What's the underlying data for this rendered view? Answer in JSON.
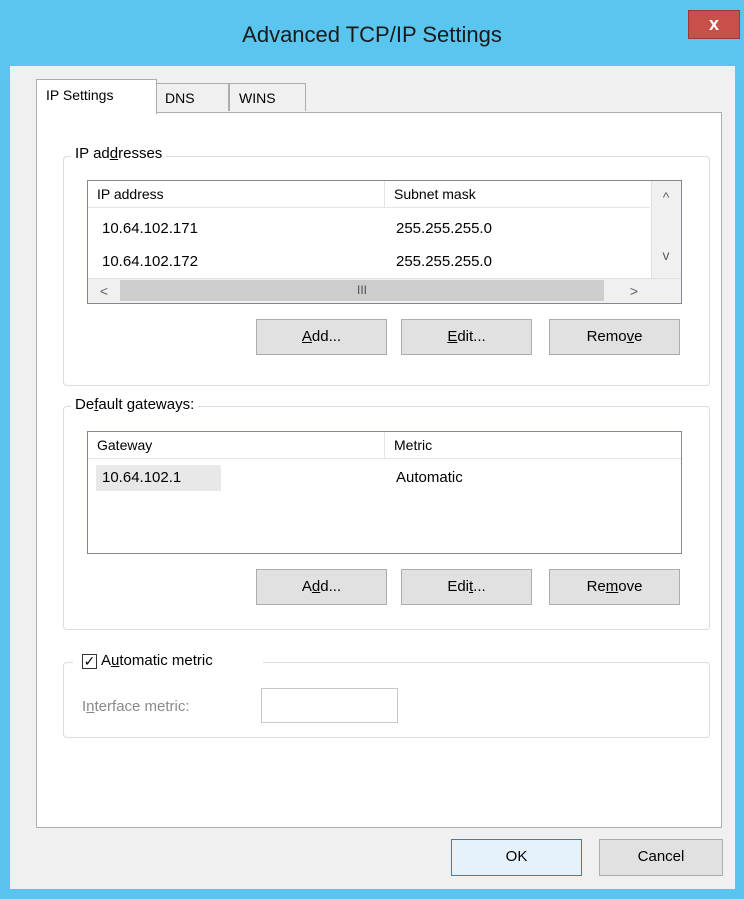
{
  "window": {
    "title": "Advanced TCP/IP Settings",
    "close_label": "x"
  },
  "tabs": [
    {
      "label": "IP Settings",
      "active": true
    },
    {
      "label": "DNS",
      "active": false
    },
    {
      "label": "WINS",
      "active": false
    }
  ],
  "ip_addresses": {
    "group_label_a": "IP ad",
    "group_label_u": "d",
    "group_label_b": "resses",
    "columns": [
      "IP address",
      "Subnet mask"
    ],
    "rows": [
      {
        "ip": "10.64.102.171",
        "mask": "255.255.255.0"
      },
      {
        "ip": "10.64.102.172",
        "mask": "255.255.255.0"
      }
    ],
    "scroll_left": "<",
    "scroll_right": ">",
    "scroll_up": "^",
    "scroll_down": "v",
    "scroll_grip": "III",
    "add_u": "A",
    "add_rest": "dd...",
    "edit_u": "E",
    "edit_rest": "dit...",
    "remove_a": "Remo",
    "remove_u": "v",
    "remove_b": "e"
  },
  "default_gateways": {
    "group_label_a": "De",
    "group_label_u": "f",
    "group_label_b": "ault gateways:",
    "columns": [
      "Gateway",
      "Metric"
    ],
    "rows": [
      {
        "gateway": "10.64.102.1",
        "metric": "Automatic"
      }
    ],
    "add_a": "A",
    "add_u": "d",
    "add_b": "d...",
    "edit_a": "Edi",
    "edit_u": "t",
    "edit_b": "...",
    "remove_a": "Re",
    "remove_u": "m",
    "remove_b": "ove"
  },
  "automatic_metric": {
    "checked": true,
    "check_glyph": "✓",
    "label_a": "A",
    "label_u": "u",
    "label_b": "tomatic metric",
    "interface_label_a": "I",
    "interface_label_u": "n",
    "interface_label_b": "terface metric:",
    "interface_value": ""
  },
  "footer": {
    "ok_label": "OK",
    "cancel_label": "Cancel"
  }
}
